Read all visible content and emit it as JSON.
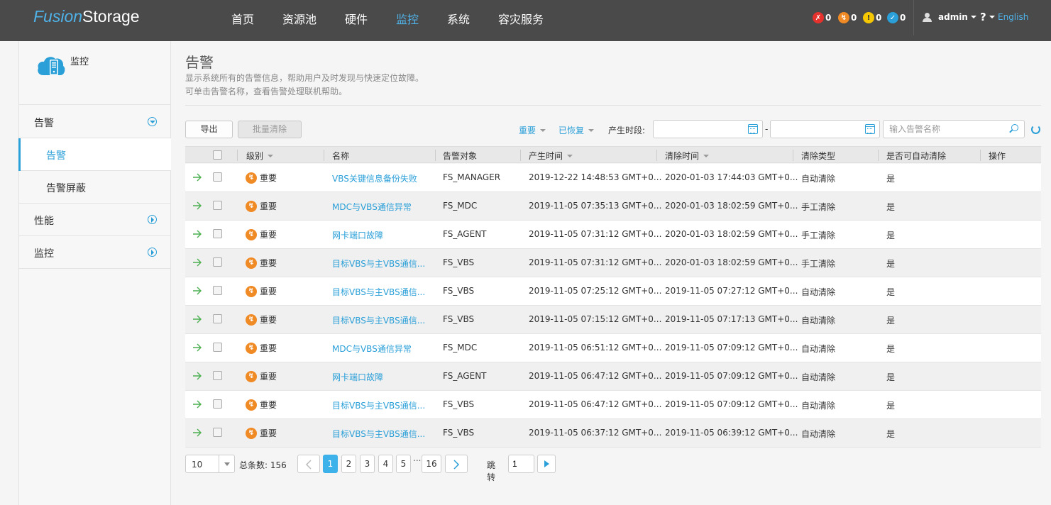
{
  "brand": {
    "part1": "Fusion",
    "part2": "Storage"
  },
  "nav": [
    {
      "label": "首页"
    },
    {
      "label": "资源池"
    },
    {
      "label": "硬件"
    },
    {
      "label": "监控",
      "active": true
    },
    {
      "label": "系统"
    },
    {
      "label": "容灾服务"
    }
  ],
  "alarm_counts": [
    {
      "name": "critical",
      "count": "0",
      "color": "#e5322d"
    },
    {
      "name": "major",
      "count": "0",
      "color": "#f08a24"
    },
    {
      "name": "minor",
      "count": "0",
      "color": "#f5c700"
    },
    {
      "name": "cleared",
      "count": "0",
      "color": "#2a9fd8"
    }
  ],
  "user": {
    "name": "admin"
  },
  "help": "?",
  "language": "English",
  "sidebar": {
    "title": "监控",
    "items": [
      {
        "label": "告警",
        "kind": "group",
        "expanded": true
      },
      {
        "label": "告警",
        "kind": "sub",
        "active": true
      },
      {
        "label": "告警屏蔽",
        "kind": "sub"
      },
      {
        "label": "性能",
        "kind": "group"
      },
      {
        "label": "监控",
        "kind": "group"
      }
    ]
  },
  "page": {
    "title": "告警",
    "desc1": "显示系统所有的告警信息，帮助用户及时发现与快速定位故障。",
    "desc2": "可单击告警名称，查看告警处理联机帮助。"
  },
  "toolbar": {
    "export_label": "导出",
    "batch_clear_label": "批量清除",
    "severity_filter": "重要",
    "status_filter": "已恢复",
    "time_label": "产生时段:",
    "start_time": "",
    "end_time": "",
    "time_sep": "-",
    "search_placeholder": "输入告警名称"
  },
  "columns": [
    "级别",
    "名称",
    "告警对象",
    "产生时间",
    "清除时间",
    "清除类型",
    "是否可自动清除",
    "操作"
  ],
  "rows": [
    {
      "severity": "重要",
      "name": "VBS关键信息备份失败",
      "object": "FS_MANAGER",
      "created": "2019-12-22 14:48:53 GMT+0...",
      "cleared": "2020-01-03 17:44:03 GMT+0...",
      "clear_type": "自动清除",
      "auto": "是"
    },
    {
      "severity": "重要",
      "name": "MDC与VBS通信异常",
      "object": "FS_MDC",
      "created": "2019-11-05 07:35:13 GMT+0...",
      "cleared": "2020-01-03 18:02:59 GMT+0...",
      "clear_type": "手工清除",
      "auto": "是"
    },
    {
      "severity": "重要",
      "name": "网卡端口故障",
      "object": "FS_AGENT",
      "created": "2019-11-05 07:31:12 GMT+0...",
      "cleared": "2020-01-03 18:02:59 GMT+0...",
      "clear_type": "手工清除",
      "auto": "是"
    },
    {
      "severity": "重要",
      "name": "目标VBS与主VBS通信...",
      "object": "FS_VBS",
      "created": "2019-11-05 07:31:12 GMT+0...",
      "cleared": "2020-01-03 18:02:59 GMT+0...",
      "clear_type": "手工清除",
      "auto": "是"
    },
    {
      "severity": "重要",
      "name": "目标VBS与主VBS通信...",
      "object": "FS_VBS",
      "created": "2019-11-05 07:25:12 GMT+0...",
      "cleared": "2019-11-05 07:27:12 GMT+0...",
      "clear_type": "自动清除",
      "auto": "是"
    },
    {
      "severity": "重要",
      "name": "目标VBS与主VBS通信...",
      "object": "FS_VBS",
      "created": "2019-11-05 07:15:12 GMT+0...",
      "cleared": "2019-11-05 07:17:13 GMT+0...",
      "clear_type": "自动清除",
      "auto": "是"
    },
    {
      "severity": "重要",
      "name": "MDC与VBS通信异常",
      "object": "FS_MDC",
      "created": "2019-11-05 06:51:12 GMT+0...",
      "cleared": "2019-11-05 07:09:12 GMT+0...",
      "clear_type": "自动清除",
      "auto": "是"
    },
    {
      "severity": "重要",
      "name": "网卡端口故障",
      "object": "FS_AGENT",
      "created": "2019-11-05 06:47:12 GMT+0...",
      "cleared": "2019-11-05 07:09:12 GMT+0...",
      "clear_type": "自动清除",
      "auto": "是"
    },
    {
      "severity": "重要",
      "name": "目标VBS与主VBS通信...",
      "object": "FS_VBS",
      "created": "2019-11-05 06:47:12 GMT+0...",
      "cleared": "2019-11-05 07:09:12 GMT+0...",
      "clear_type": "自动清除",
      "auto": "是"
    },
    {
      "severity": "重要",
      "name": "目标VBS与主VBS通信...",
      "object": "FS_VBS",
      "created": "2019-11-05 06:37:12 GMT+0...",
      "cleared": "2019-11-05 06:39:12 GMT+0...",
      "clear_type": "自动清除",
      "auto": "是"
    }
  ],
  "pagination": {
    "page_size": "10",
    "total_label": "总条数: 156",
    "pages": [
      "1",
      "2",
      "3",
      "4",
      "5",
      "16"
    ],
    "current": "1",
    "ellipsis": "...",
    "jump_label": "跳转",
    "jump_value": "1"
  }
}
